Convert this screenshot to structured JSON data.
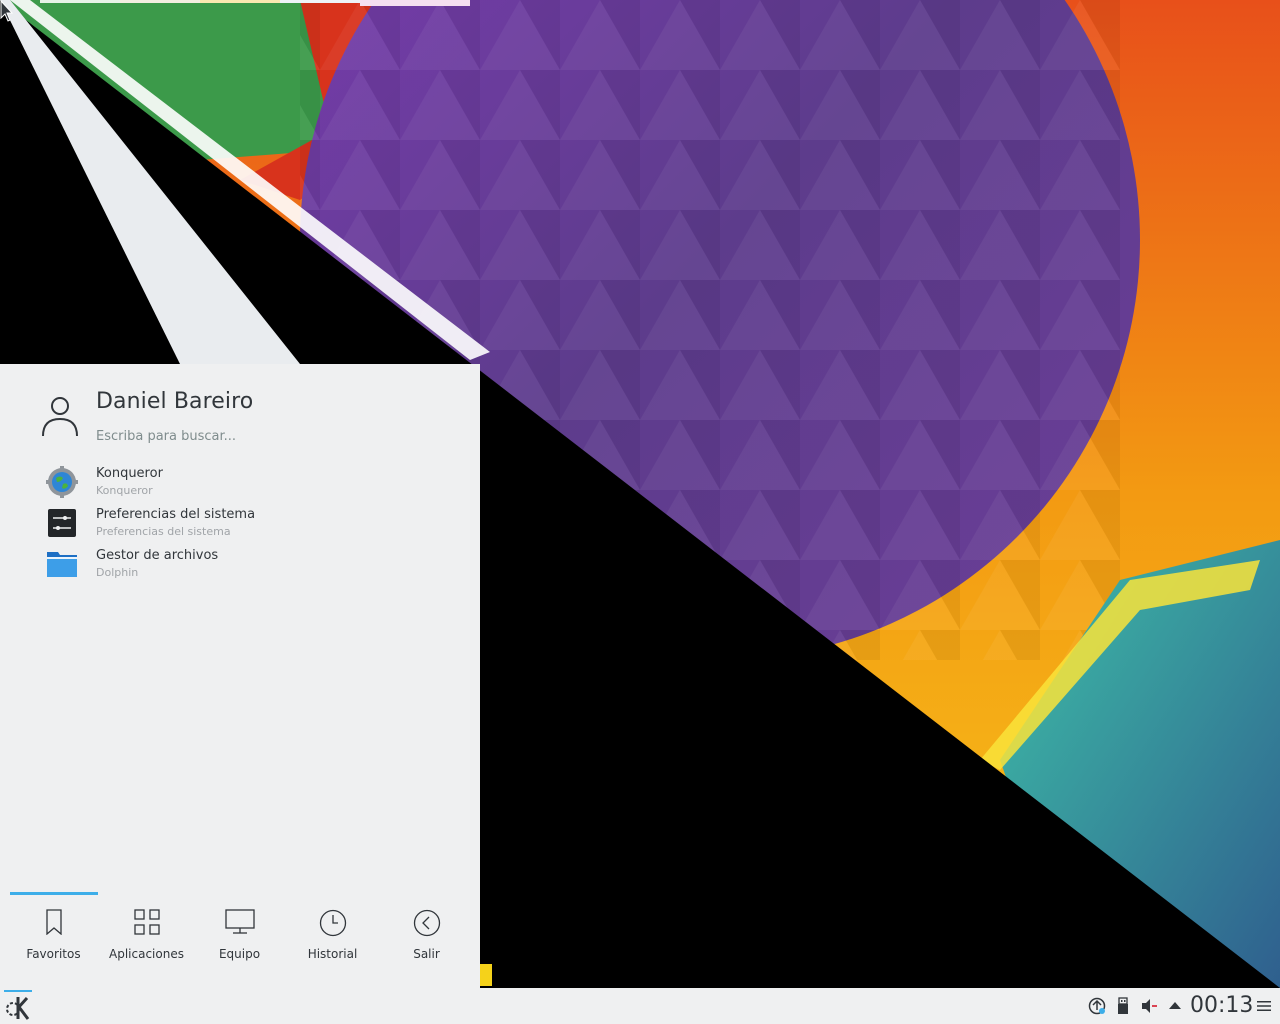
{
  "launcher": {
    "user_name": "Daniel Bareiro",
    "search_placeholder": "Escriba para buscar...",
    "favorites": [
      {
        "name": "Konqueror",
        "description": "Konqueror",
        "icon": "globe-gear-icon"
      },
      {
        "name": "Preferencias del sistema",
        "description": "Preferencias del sistema",
        "icon": "system-settings-icon"
      },
      {
        "name": "Gestor de archivos",
        "description": "Dolphin",
        "icon": "folder-icon"
      }
    ],
    "tabs": [
      {
        "label": "Favoritos",
        "icon": "bookmark-icon",
        "active": true
      },
      {
        "label": "Aplicaciones",
        "icon": "grid-icon",
        "active": false
      },
      {
        "label": "Equipo",
        "icon": "computer-icon",
        "active": false
      },
      {
        "label": "Historial",
        "icon": "clock-icon",
        "active": false
      },
      {
        "label": "Salir",
        "icon": "back-circle-icon",
        "active": false
      }
    ]
  },
  "panel": {
    "clock": "00:13",
    "tray_icons": [
      "updates-icon",
      "usb-device-icon",
      "volume-muted-icon",
      "expand-arrow-icon",
      "panel-menu-icon"
    ]
  },
  "colors": {
    "accent": "#3daee9",
    "launcher_bg": "#eff0f1",
    "text": "#31363b",
    "subtext": "#a0a4a8"
  }
}
